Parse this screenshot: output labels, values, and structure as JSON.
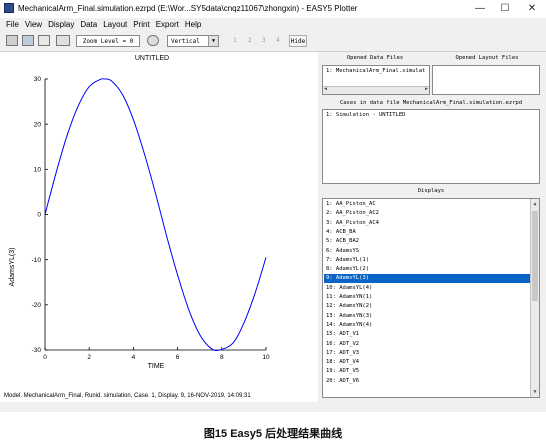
{
  "window": {
    "title": "MechanicalArm_Final.simulation.ezrpd (E:\\Wor...SY5data\\cnqz11067\\zhongxin) - EASY5 Plotter",
    "minimize": "—",
    "maximize": "☐",
    "close": "✕"
  },
  "menu": [
    "File",
    "View",
    "Display",
    "Data",
    "Layout",
    "Print",
    "Export",
    "Help"
  ],
  "toolbar": {
    "zoom_label": "Zoom Level = 0",
    "orientation": "Vertical",
    "pages": [
      "1",
      "2",
      "3",
      "4"
    ],
    "hide_label": "Hide"
  },
  "plot": {
    "title": "UNTITLED",
    "footer": "Model. MechanicalArm_Final, Runid. simulation, Case. 1, Display. 9, 16-NOV-2019, 14:09:31"
  },
  "chart_data": {
    "type": "line",
    "title": "UNTITLED",
    "xlabel": "TIME",
    "ylabel": "AdamsYL(3)",
    "xlim": [
      0,
      10
    ],
    "ylim": [
      -30,
      30
    ],
    "x_ticks": [
      "0",
      "2",
      "4",
      "6",
      "8",
      "10"
    ],
    "y_ticks": [
      "30",
      "20",
      "10",
      "0",
      "-10",
      "-20",
      "-30"
    ],
    "grid": false,
    "series": [
      {
        "color": "#0000ff",
        "x": [
          0,
          0.5,
          1,
          1.5,
          2,
          2.5,
          2.7,
          3,
          3.5,
          4,
          4.5,
          5,
          5.5,
          6,
          6.5,
          7,
          7.5,
          7.9,
          8.5,
          9,
          9.5,
          10
        ],
        "y": [
          0,
          9.2,
          17.5,
          24.0,
          28.3,
          29.9,
          30,
          29.6,
          26.6,
          21.0,
          13.4,
          4.7,
          -4.7,
          -13.4,
          -21.0,
          -26.6,
          -29.6,
          -30,
          -28.5,
          -24.0,
          -17.5,
          -9.5
        ]
      }
    ]
  },
  "opened_data_files": {
    "header": "Opened Data Files",
    "items": [
      "1: MechanicalArm_Final.simulat"
    ]
  },
  "opened_layout_files": {
    "header": "Opened Layout Files"
  },
  "cases": {
    "header": "Cases in data file  MechanicalArm_Final.simulation.ezrpd",
    "items": [
      "1: Simulation - UNTITLED"
    ]
  },
  "displays": {
    "header": "Displays",
    "selected_index": 8,
    "items": [
      "1: AA_Piston_AC",
      "2: AA_Piston_AC2",
      "3: AA_Piston_AC4",
      "4: ACB_BA",
      "5: ACB_BA2",
      "6: AdamsYS",
      "7: AdamsYL(1)",
      "8: AdamsYL(2)",
      "9: AdamsYL(3)",
      "10: AdamsYL(4)",
      "11: AdamsYN(1)",
      "12: AdamsYN(2)",
      "13: AdamsYN(3)",
      "14: AdamsYN(4)",
      "15: ADT_V1",
      "16: ADT_V2",
      "17: ADT_V3",
      "18: ADT_V4",
      "19: ADT_V5",
      "20: ADT_V6"
    ]
  },
  "caption": "图15 Easy5 后处理结果曲线"
}
